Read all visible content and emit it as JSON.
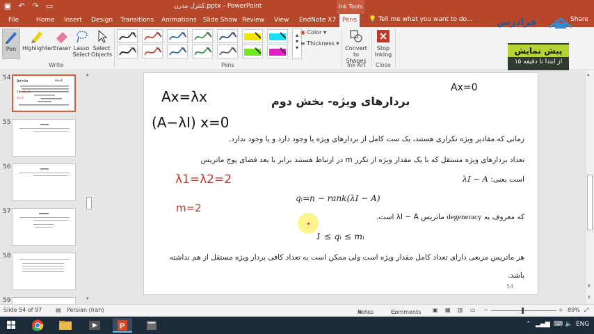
{
  "window": {
    "title": "کنترل مدرن.pptx - PowerPoint",
    "context_tab_group": "Ink Tools"
  },
  "tabs": [
    {
      "label": "File"
    },
    {
      "label": "Home"
    },
    {
      "label": "Insert"
    },
    {
      "label": "Design"
    },
    {
      "label": "Transitions"
    },
    {
      "label": "Animations"
    },
    {
      "label": "Slide Show"
    },
    {
      "label": "Review"
    },
    {
      "label": "View"
    },
    {
      "label": "EndNote X7"
    },
    {
      "label": "Pens"
    }
  ],
  "tell_me": "Tell me what you want to do...",
  "share_label": "Share",
  "ribbon": {
    "write_group": {
      "label": "Write",
      "pen": "Pen",
      "highlighter": "Highlighter",
      "eraser": "Eraser",
      "lasso_select": [
        "Lasso",
        "Select"
      ],
      "select_objects": [
        "Select",
        "Objects"
      ]
    },
    "pens_group": {
      "label": "Pens",
      "color_label": "Color",
      "thickness_label": "Thickness",
      "pen_colors": [
        "#1a1a1a",
        "#c0392b",
        "#1f5fbf",
        "#2e8b3a",
        "#1a3f8a",
        "#f2e600",
        "#19e0f0",
        "#1a1a1a",
        "#c0392b",
        "#1f5fbf",
        "#2e8b3a",
        "#555555",
        "#6ee81c",
        "#e81cc7"
      ]
    },
    "ink_art_group": {
      "label": "Ink Art",
      "convert": [
        "Convert",
        "to Shapes"
      ]
    },
    "close_group": {
      "label": "Close",
      "stop_inking": [
        "Stop",
        "Inking"
      ]
    }
  },
  "ad": {
    "brand": "فرادرس",
    "line1": "پیش نمایش",
    "line2": "از ابتدا تا دقیقه ۱۵"
  },
  "thumbnails": [
    {
      "number": "54",
      "selected": true
    },
    {
      "number": "55",
      "selected": false
    },
    {
      "number": "56",
      "selected": false
    },
    {
      "number": "57",
      "selected": false
    },
    {
      "number": "58",
      "selected": false
    },
    {
      "number": "59",
      "selected": false
    }
  ],
  "slide": {
    "title": "بردارهای ویژه- بخش دوم",
    "para1": "زمانی که مقادیر ویژه تکراری هستند، یک ست کامل از بردارهای ویژه یا وجود دارد و یا وجود ندارد.",
    "para2": "تعداد بردارهای ویژه مستقل که با یک مقدار ویژه از تکرر m در ارتباط هستند برابر با بعد فضای پوچ ماتریس",
    "matrix_expr": "λI − A",
    "is_label": "است یعنی:",
    "formula_q": "qᵢ=n − rank(λI − A)",
    "degeneracy_text_start": "که معروف به",
    "degeneracy_word": "degeneracy",
    "degeneracy_text_end": "ماتریس λI − A است.",
    "inequality": "1 ≤ qᵢ ≤ mᵢ",
    "para3": "هر ماتریس مربعی دارای تعداد کامل مقدار ویژه است ولی ممکن است به تعداد کافی بردار ویژه مستقل از هم نداشته",
    "para3_end": "باشد.",
    "page_number": "54",
    "handwriting": {
      "axlx": "Ax=λx",
      "alix": "(A−λI) x=0",
      "lambdas": "λ1=λ2=2",
      "m2": "m=2",
      "ax0": "Ax=0"
    }
  },
  "status": {
    "slide_info": "Slide 54 of 97",
    "language": "Persian (Iran)",
    "notes": "Notes",
    "comments": "Comments",
    "zoom": "89%"
  },
  "taskbar": {
    "lang": "ENG"
  }
}
